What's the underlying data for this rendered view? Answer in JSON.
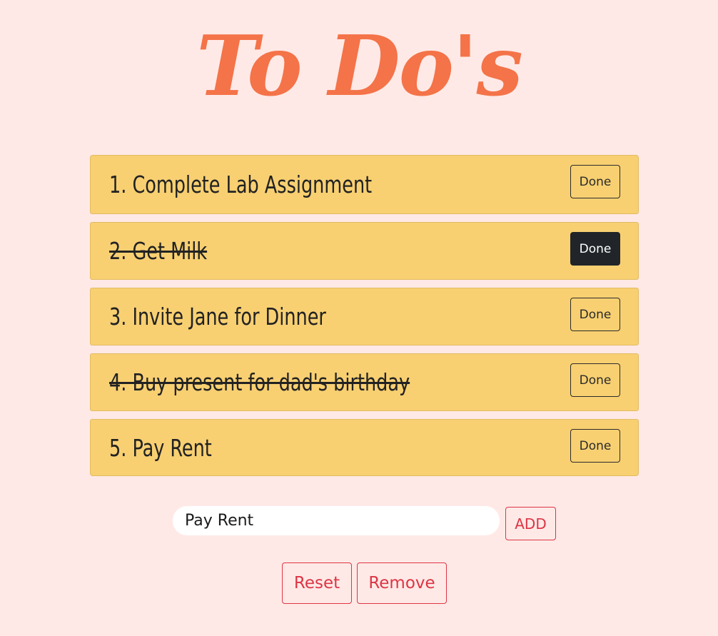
{
  "app": {
    "title": "To Do's"
  },
  "todos": [
    {
      "text": "1. Complete Lab Assignment",
      "done": false,
      "button_label": "Done"
    },
    {
      "text": "2. Get Milk",
      "done": true,
      "button_label": "Done"
    },
    {
      "text": "3. Invite Jane for Dinner",
      "done": false,
      "button_label": "Done"
    },
    {
      "text": "4. Buy present for dad's birthday",
      "done": true,
      "button_label": "Done"
    },
    {
      "text": "5. Pay Rent",
      "done": false,
      "button_label": "Done"
    }
  ],
  "add_form": {
    "input_value": "Pay Rent",
    "add_label": "ADD"
  },
  "actions": {
    "reset_label": "Reset",
    "remove_label": "Remove"
  },
  "colors": {
    "background": "#ffe9e6",
    "title": "#f47348",
    "item_background": "#f8d072",
    "danger": "#dc3545",
    "dark": "#212529"
  }
}
